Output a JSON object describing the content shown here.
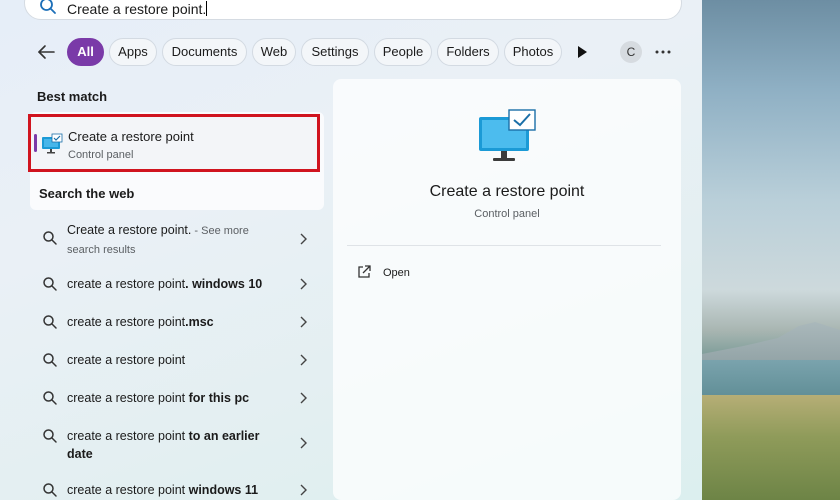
{
  "search": {
    "query": "Create a restore point."
  },
  "filters": {
    "chips": [
      "All",
      "Apps",
      "Documents",
      "Web",
      "Settings",
      "People",
      "Folders",
      "Photos"
    ],
    "active": "All",
    "avatar_initial": "C"
  },
  "best_match": {
    "heading": "Best match",
    "item": {
      "title": "Create a restore point",
      "subtitle": "Control panel",
      "icon": "monitor-check-icon"
    }
  },
  "web": {
    "heading": "Search the web",
    "results": [
      {
        "plain": "Create a restore point.",
        "bold": "",
        "extra": " - See more search results"
      },
      {
        "plain": "create a restore point",
        "bold": ". windows 10",
        "extra": ""
      },
      {
        "plain": "create a restore point",
        "bold": ".msc",
        "extra": ""
      },
      {
        "plain": "create a restore point",
        "bold": "",
        "extra": ""
      },
      {
        "plain": "create a restore point ",
        "bold": "for this pc",
        "extra": ""
      },
      {
        "plain": "create a restore point ",
        "bold": "to an earlier date",
        "extra": ""
      },
      {
        "plain": "create a restore point ",
        "bold": "windows 11",
        "extra": ""
      }
    ]
  },
  "detail": {
    "title": "Create a restore point",
    "subtitle": "Control panel",
    "actions": [
      {
        "label": "Open",
        "icon": "open-external-icon"
      }
    ]
  },
  "colors": {
    "accent": "#7a3aa8",
    "highlight_border": "#d0141f"
  }
}
